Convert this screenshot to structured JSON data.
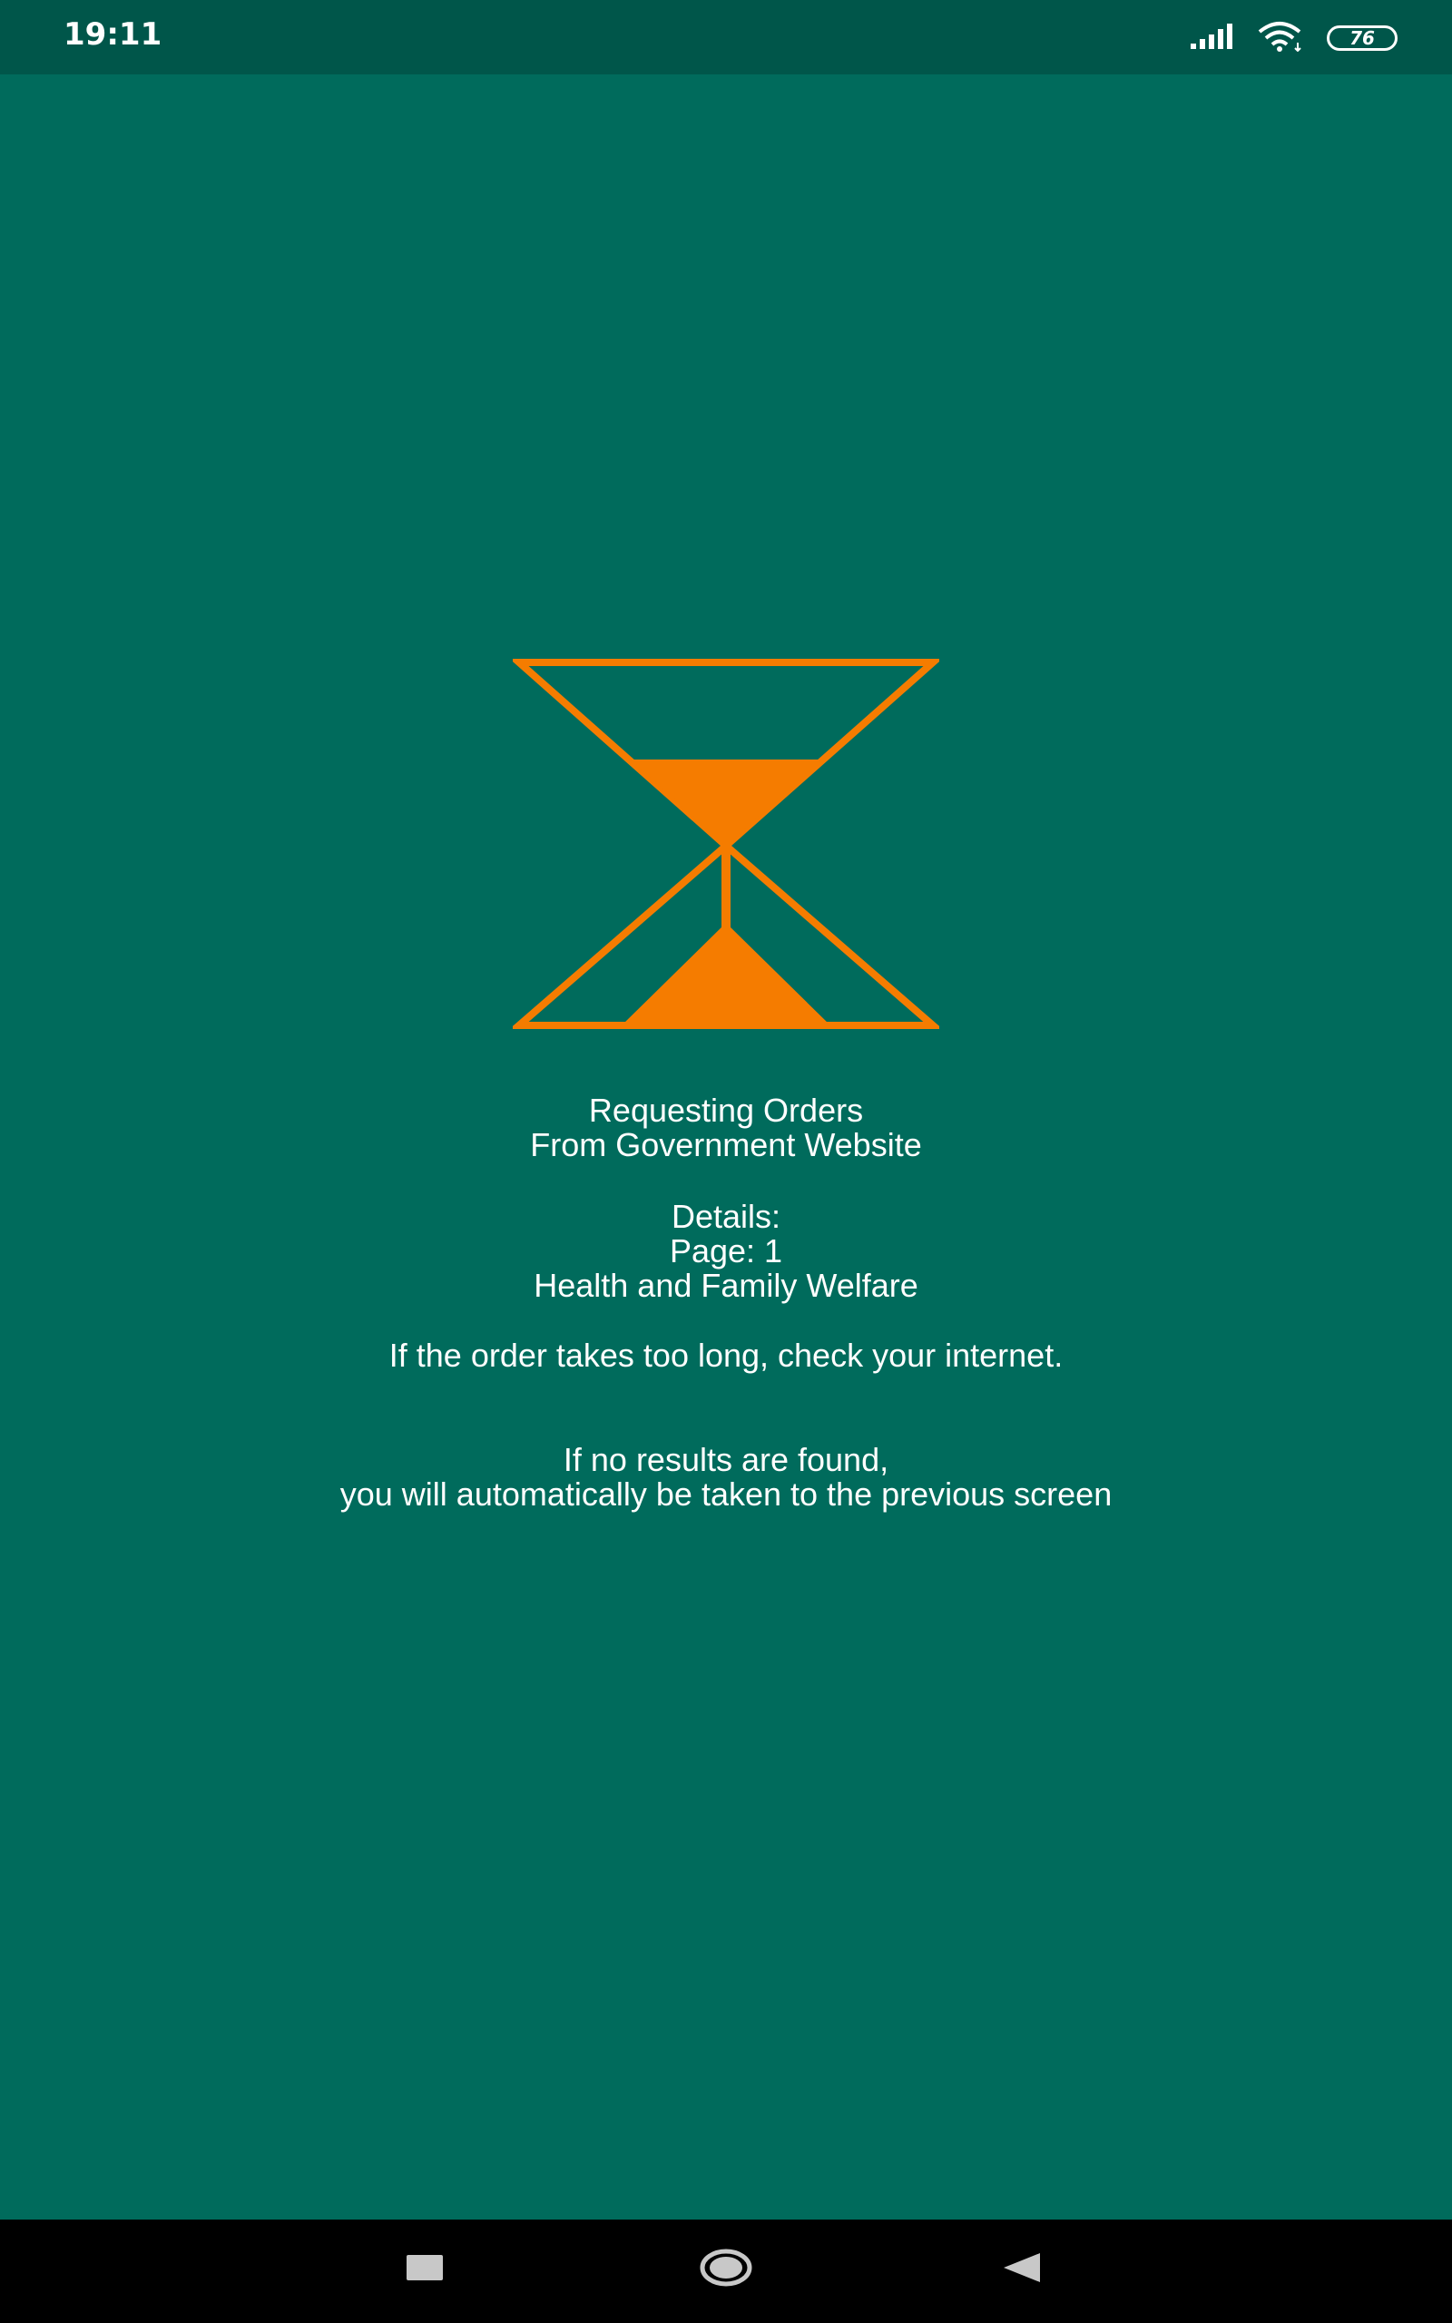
{
  "status_bar": {
    "time": "19:11",
    "battery_level": "76",
    "icons": [
      "signal-icon",
      "wifi-icon",
      "battery-icon"
    ]
  },
  "loading": {
    "icon": "hourglass-icon",
    "accent_color": "#f57c00",
    "title_line1": "Requesting Orders",
    "title_line2": "From Government Website",
    "details_label": "Details:",
    "page_label": "Page: 1",
    "department": "Health and Family Welfare",
    "warning": "If the order takes too long, check your internet.",
    "no_results_line1": "If no results are found,",
    "no_results_line2": "you will automatically be taken to the previous screen"
  },
  "nav_bar": {
    "buttons": [
      "recents-icon",
      "home-icon",
      "back-icon"
    ]
  },
  "colors": {
    "background": "#006b5c",
    "status_bar": "#00564a",
    "nav_bar": "#000000",
    "text": "#ffffff"
  }
}
